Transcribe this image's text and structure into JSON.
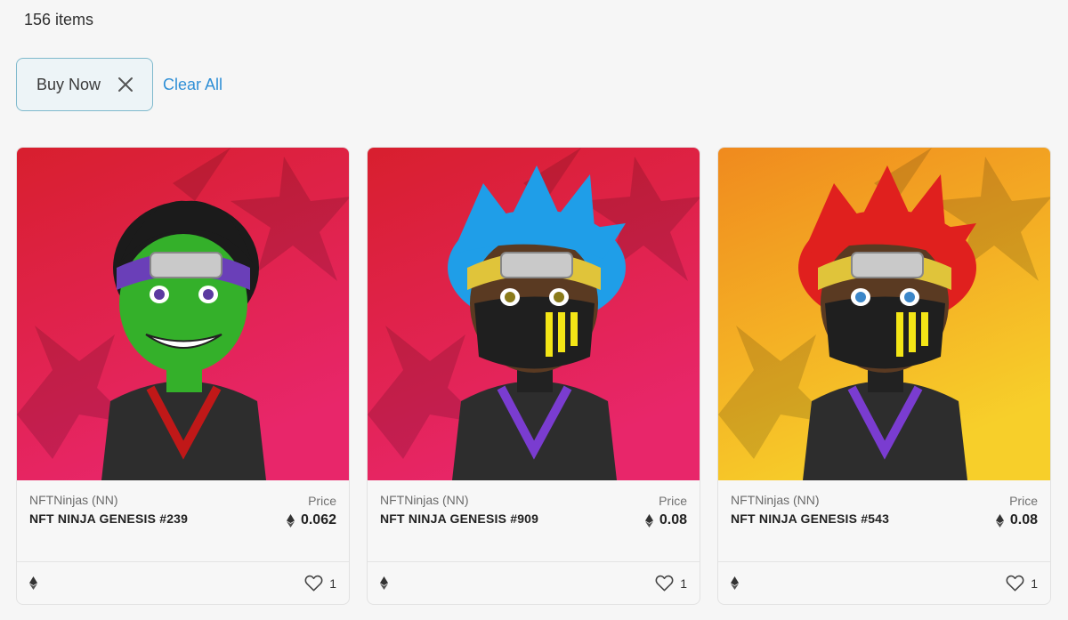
{
  "results": {
    "count_text": "156 items"
  },
  "filters": {
    "active": [
      {
        "label": "Buy Now",
        "remove_icon": "close-icon"
      }
    ],
    "clear_label": "Clear All"
  },
  "cards": [
    {
      "collection": "NFTNinjas (NN)",
      "name": "NFT NINJA GENESIS #239",
      "price_label": "Price",
      "price": "0.062",
      "likes": "1",
      "bg_top": "#d81f2e",
      "bg_bottom": "#e8266a",
      "skin": "#34b02a",
      "hair": "#1b1b1b",
      "band": "#6a3fb8"
    },
    {
      "collection": "NFTNinjas (NN)",
      "name": "NFT NINJA GENESIS #909",
      "price_label": "Price",
      "price": "0.08",
      "likes": "1",
      "bg_top": "#d81f2e",
      "bg_bottom": "#e8266a",
      "skin": "#5a3a22",
      "hair": "#1f9ee8",
      "band": "#e0c43a"
    },
    {
      "collection": "NFTNinjas (NN)",
      "name": "NFT NINJA GENESIS #543",
      "price_label": "Price",
      "price": "0.08",
      "likes": "1",
      "bg_top": "#f08a1e",
      "bg_bottom": "#f7cf2a",
      "skin": "#5a3a22",
      "hair": "#e0201e",
      "band": "#e0c43a"
    }
  ]
}
